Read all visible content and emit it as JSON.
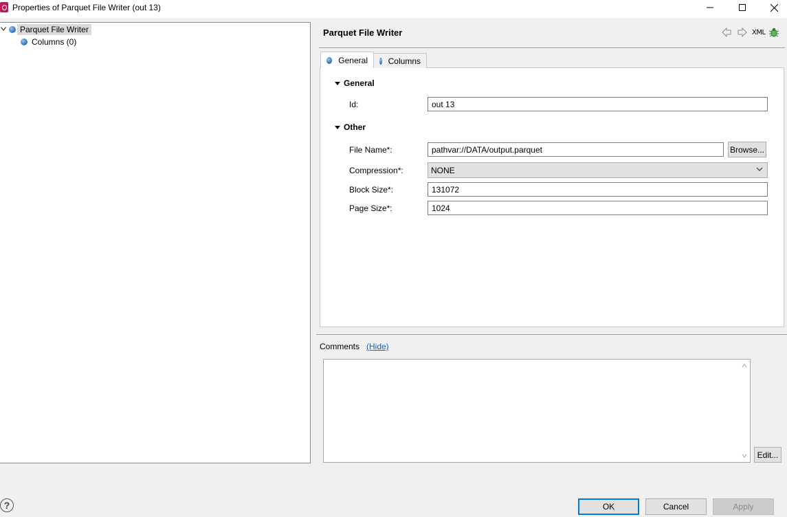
{
  "window": {
    "title": "Properties of Parquet File Writer (out 13)"
  },
  "tree": {
    "items": [
      {
        "label": "Parquet File Writer",
        "expanded": true,
        "selected": true
      },
      {
        "label": "Columns (0)"
      }
    ]
  },
  "header": {
    "title": "Parquet File Writer",
    "xml_label": "XML"
  },
  "tabs": [
    {
      "label": "General",
      "active": true
    },
    {
      "label": "Columns",
      "active": false
    }
  ],
  "general_section": {
    "title": "General",
    "id_label": "Id:",
    "id_value": "out 13"
  },
  "other_section": {
    "title": "Other",
    "file_name_label": "File Name*:",
    "file_name_value": "pathvar://DATA/output.parquet",
    "browse_label": "Browse...",
    "compression_label": "Compression*:",
    "compression_value": "NONE",
    "block_size_label": "Block Size*:",
    "block_size_value": "131072",
    "page_size_label": "Page Size*:",
    "page_size_value": "1024"
  },
  "comments": {
    "label": "Comments",
    "hide_link": "(Hide)",
    "value": "",
    "edit_label": "Edit..."
  },
  "footer": {
    "help_glyph": "?",
    "ok_label": "OK",
    "cancel_label": "Cancel",
    "apply_label": "Apply",
    "apply_enabled": false
  },
  "colors": {
    "app_icon": "#c2185b",
    "link": "#1a5fb4",
    "default_button_border": "#0078d7",
    "bullet": "#3c7dc4"
  }
}
